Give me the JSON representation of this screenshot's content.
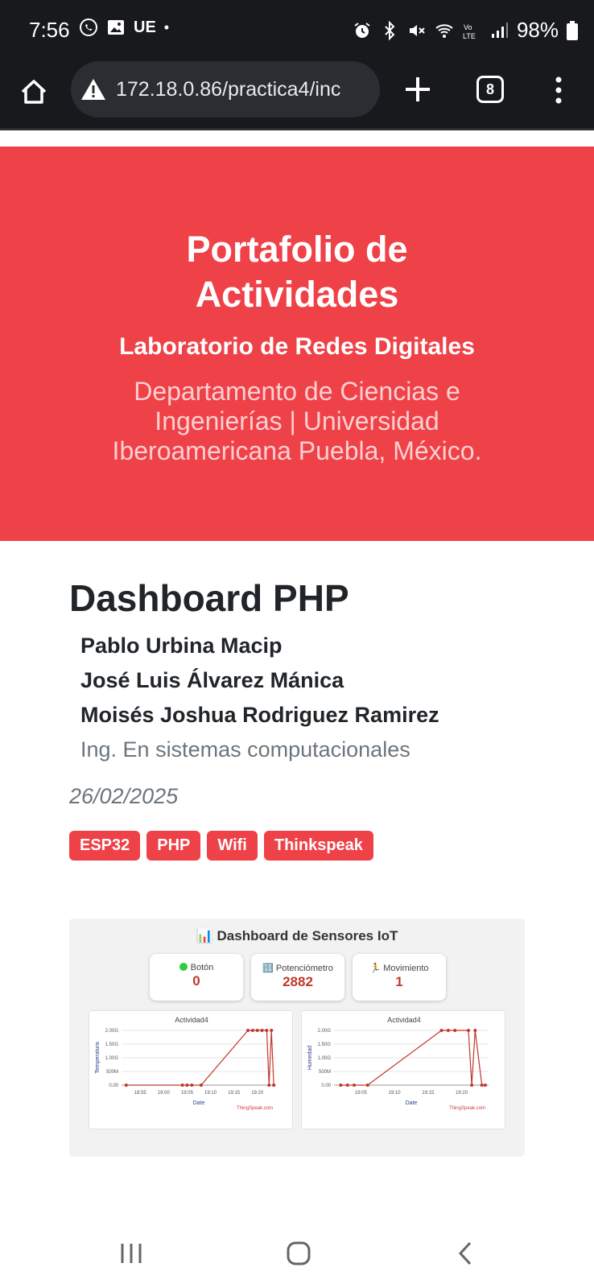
{
  "status_bar": {
    "time": "7:56",
    "carrier": "UE",
    "battery": "98%",
    "icons_left": [
      "whatsapp-icon",
      "gallery-icon",
      "dot-icon"
    ],
    "icons_right": [
      "alarm-icon",
      "bluetooth-icon",
      "mute-icon",
      "wifi-icon",
      "volte-icon",
      "signal-icon",
      "battery-icon"
    ]
  },
  "browser": {
    "url": "172.18.0.86/practica4/inc",
    "tab_count": "8"
  },
  "hero": {
    "title": "Portafolio de Actividades",
    "subtitle": "Laboratorio de Redes Digitales",
    "department": "Departamento de Ciencias e Ingenierías | Universidad Iberoamericana Puebla, México."
  },
  "post": {
    "title": "Dashboard PHP",
    "authors": [
      "Pablo Urbina Macip",
      "José Luis Álvarez Mánica",
      "Moisés Joshua Rodriguez Ramirez"
    ],
    "career": "Ing. En sistemas computacionales",
    "date": "26/02/2025",
    "tags": [
      "ESP32",
      "PHP",
      "Wifi",
      "Thinkspeak"
    ]
  },
  "dashboard": {
    "title": "📊 Dashboard de Sensores IoT",
    "cards": [
      {
        "label": "Botón",
        "value": "0",
        "icon": "green-dot-icon"
      },
      {
        "label": "🔢 Potenciómetro",
        "value": "2882",
        "icon": "number-icon"
      },
      {
        "label": "🏃 Movimiento",
        "value": "1",
        "icon": "running-icon"
      }
    ]
  },
  "chart_data": [
    {
      "type": "line",
      "title": "Actividad4",
      "xlabel": "Date",
      "ylabel": "Temperatura",
      "credit": "ThingSpeak.com",
      "x_ticks": [
        "18:55",
        "19:00",
        "19:05",
        "19:10",
        "19:15",
        "19:20"
      ],
      "y_ticks": [
        "0.00",
        "500M",
        "1.00G",
        "1.50G",
        "2.00G"
      ],
      "ylim": [
        0,
        2.0
      ],
      "y_unit": "G",
      "x": [
        "18:52",
        "19:04",
        "19:05",
        "19:06",
        "19:08",
        "19:18",
        "19:19",
        "19:20",
        "19:21",
        "19:22",
        "19:22.5",
        "19:23",
        "19:23.5"
      ],
      "values": [
        0,
        0,
        0,
        0,
        0,
        2.0,
        2.0,
        2.0,
        2.0,
        2.0,
        0,
        2.0,
        0
      ]
    },
    {
      "type": "line",
      "title": "Actividad4",
      "xlabel": "Date",
      "ylabel": "Humedad",
      "credit": "ThingSpeak.com",
      "x_ticks": [
        "19:05",
        "19:10",
        "19:15",
        "19:20"
      ],
      "y_ticks": [
        "0.00",
        "500M",
        "1.00G",
        "1.50G",
        "2.00G"
      ],
      "ylim": [
        0,
        2.0
      ],
      "y_unit": "G",
      "x": [
        "19:02",
        "19:03",
        "19:04",
        "19:06",
        "19:17",
        "19:18",
        "19:19",
        "19:21",
        "19:21.5",
        "19:22",
        "19:23",
        "19:23.5"
      ],
      "values": [
        0,
        0,
        0,
        0,
        2.0,
        2.0,
        2.0,
        2.0,
        0,
        2.0,
        0,
        0
      ]
    }
  ]
}
